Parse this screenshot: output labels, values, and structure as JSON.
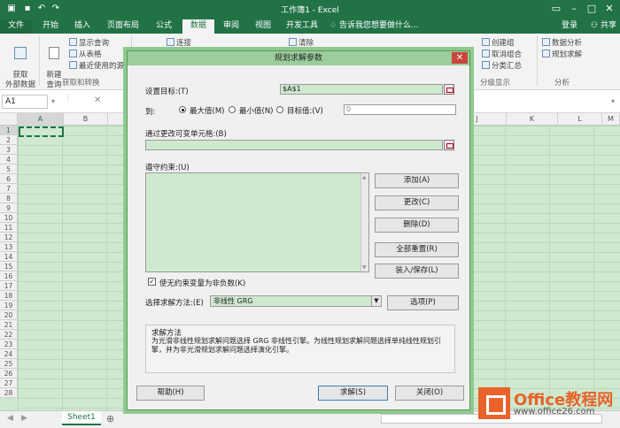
{
  "window": {
    "title": "工作簿1 - Excel"
  },
  "tabs": [
    "文件",
    "开始",
    "插入",
    "页面布局",
    "公式",
    "数据",
    "审阅",
    "视图",
    "开发工具"
  ],
  "active_tab": "数据",
  "tell_me": "告诉我您想要做什么...",
  "account": {
    "login": "登录",
    "share": "共享"
  },
  "ribbon": {
    "get_external": "获取\n外部数据",
    "new_query": "新建\n查询",
    "show_query": "显示查询",
    "from_table": "从表格",
    "recent_sources": "最近使用的源",
    "group_get_transform": "获取和转换",
    "connections": "连接",
    "clear": "清除",
    "create_group": "创建组",
    "ungroup": "取消组合",
    "subtotal": "分类汇总",
    "group_outline": "分级显示",
    "data_analysis": "数据分析",
    "solver": "规划求解",
    "group_analysis": "分析"
  },
  "formula_bar": {
    "name_box": "A1"
  },
  "grid": {
    "columns": [
      "A",
      "B",
      "J",
      "K",
      "L",
      "M"
    ],
    "rows": [
      "1",
      "2",
      "3",
      "4",
      "5",
      "6",
      "7",
      "8",
      "9",
      "10",
      "11",
      "12",
      "13",
      "14",
      "15",
      "16",
      "17",
      "18",
      "19",
      "20",
      "21",
      "22",
      "23",
      "24",
      "25",
      "26",
      "27",
      "28"
    ]
  },
  "sheet_tabs": [
    "Sheet1"
  ],
  "dialog": {
    "title": "规划求解参数",
    "set_objective_label": "设置目标:(T)",
    "set_objective_value": "$A$1",
    "to_label": "到:",
    "opt_max": "最大值(M)",
    "opt_min": "最小值(N)",
    "opt_value": "目标值:(V)",
    "target_value": "0",
    "variable_cells_label": "通过更改可变单元格:(B)",
    "constraints_label": "遵守约束:(U)",
    "btn_add": "添加(A)",
    "btn_change": "更改(C)",
    "btn_delete": "删除(D)",
    "btn_reset": "全部重置(R)",
    "btn_load_save": "装入/保存(L)",
    "nonneg_label": "使无约束变量为非负数(K)",
    "method_label": "选择求解方法:(E)",
    "method_value": "非线性 GRG",
    "btn_options": "选项(P)",
    "method_group_title": "求解方法",
    "method_desc": "为光滑非线性规划求解问题选择 GRG 非线性引擎。为线性规划求解问题选择单纯线性规划引擎，并为非光滑规划求解问题选择演化引擎。",
    "btn_help": "帮助(H)",
    "btn_solve": "求解(S)",
    "btn_close": "关闭(O)"
  },
  "watermark": {
    "main": "Office教程网",
    "url": "www.office26.com"
  }
}
